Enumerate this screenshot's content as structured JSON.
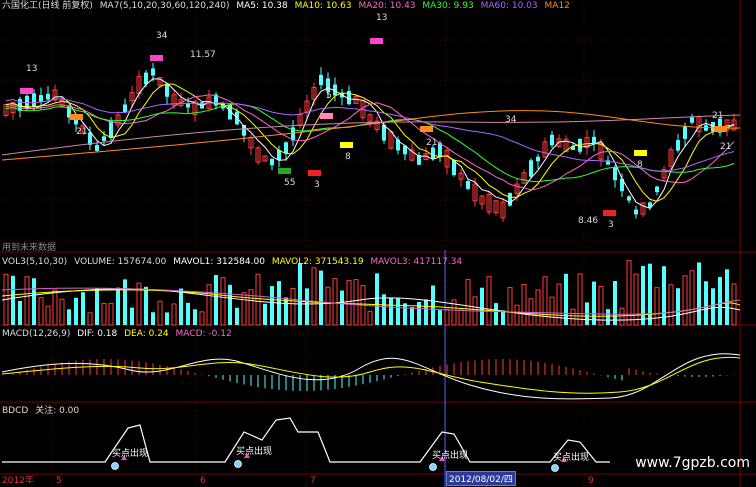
{
  "main_header": {
    "title": "六国化工(日线 前复权)",
    "ma_params": "MA7(5,10,20,30,60,120,240)",
    "ma5": "MA5: 10.38",
    "ma10": "MA10: 10.63",
    "ma20": "MA20: 10.43",
    "ma30": "MA30: 9.93",
    "ma60": "MA60: 10.03",
    "ma120": "MA12"
  },
  "colors": {
    "up": "#ff3c3c",
    "down": "#54ffff",
    "ma5": "#ffffff",
    "ma10": "#ffff00",
    "ma20": "#ff66cc",
    "ma30": "#33ff33",
    "ma60": "#aa66ff",
    "ma120": "#ff8c1a",
    "grid": "#7a0000"
  },
  "annotations": {
    "n13_a": "13",
    "n34": "34",
    "p1157": "11.57",
    "n5": "5",
    "n13_b": "13",
    "n21_a": "21",
    "n21_b": "21",
    "n34_b": "34",
    "n55": "55",
    "n3_a": "3",
    "n8_a": "8",
    "n8_b": "8",
    "n3_b": "3",
    "p846": "8.46",
    "n21_c": "21",
    "n21_d": "21"
  },
  "no_data_text": "用到未来数据",
  "vol_header": {
    "name": "VOL3(5,10,30)",
    "volume": "VOLUME: 157674.00",
    "mavol1": "MAVOL1: 312584.00",
    "mavol2": "MAVOL2: 371543.19",
    "mavol3": "MAVOL3: 417117.34"
  },
  "macd_header": {
    "name": "MACD(12,26,9)",
    "dif": "DIF: 0.18",
    "dea": "DEA: 0.24",
    "macd": "MACD: -0.12"
  },
  "bdcd_header": {
    "name": "BDCD",
    "attention": "关注: 0.00"
  },
  "signals": [
    "买点出现",
    "买点出现",
    "买点出现",
    "买点出现"
  ],
  "x_axis": {
    "year": "2012年",
    "m5": "5",
    "m6": "6",
    "m7": "7",
    "date_box": "2012/08/02/四",
    "m9": "9"
  },
  "watermark": "www.7gpzb.com"
}
